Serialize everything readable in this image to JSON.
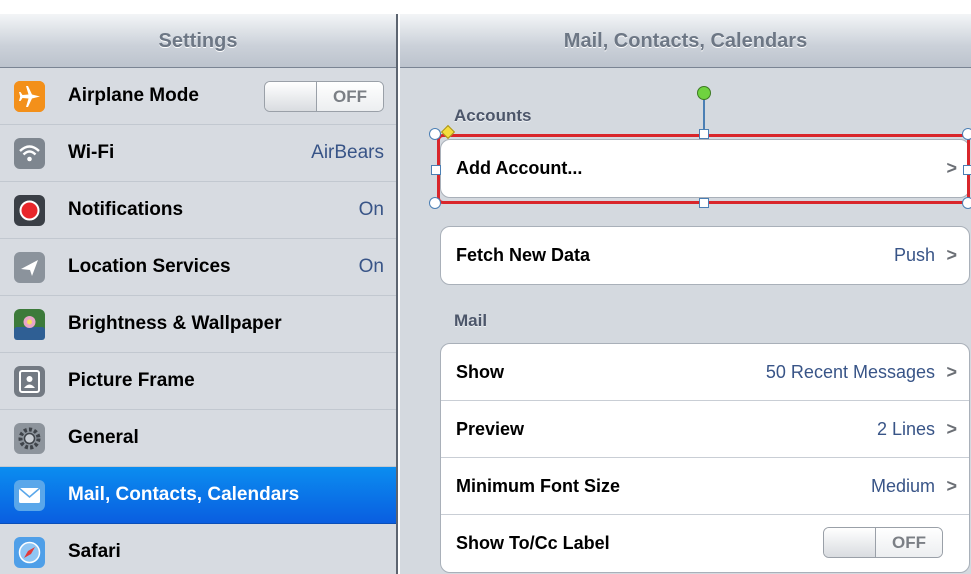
{
  "sidebar": {
    "title": "Settings",
    "items": [
      {
        "label": "Airplane Mode",
        "value": "",
        "toggle": "OFF",
        "icon": "airplane-icon"
      },
      {
        "label": "Wi-Fi",
        "value": "AirBears",
        "icon": "wifi-icon"
      },
      {
        "label": "Notifications",
        "value": "On",
        "icon": "notifications-icon"
      },
      {
        "label": "Location Services",
        "value": "On",
        "icon": "location-icon"
      },
      {
        "label": "Brightness & Wallpaper",
        "value": "",
        "icon": "brightness-wallpaper-icon"
      },
      {
        "label": "Picture Frame",
        "value": "",
        "icon": "picture-frame-icon"
      },
      {
        "label": "General",
        "value": "",
        "icon": "general-gear-icon"
      },
      {
        "label": "Mail, Contacts, Calendars",
        "value": "",
        "icon": "mail-icon",
        "selected": true
      },
      {
        "label": "Safari",
        "value": "",
        "icon": "safari-compass-icon"
      }
    ]
  },
  "detail": {
    "title": "Mail, Contacts, Calendars",
    "accounts_header": "Accounts",
    "add_account": "Add Account...",
    "fetch_new_data": {
      "label": "Fetch New Data",
      "value": "Push"
    },
    "mail_header": "Mail",
    "mail_rows": [
      {
        "label": "Show",
        "value": "50 Recent Messages"
      },
      {
        "label": "Preview",
        "value": "2 Lines"
      },
      {
        "label": "Minimum Font Size",
        "value": "Medium"
      },
      {
        "label": "Show To/Cc Label",
        "toggle": "OFF"
      }
    ],
    "chevron": ">"
  },
  "colors": {
    "selected_row": "#0a6fe8",
    "value_text": "#385487",
    "selection_outline": "#d9262b"
  }
}
